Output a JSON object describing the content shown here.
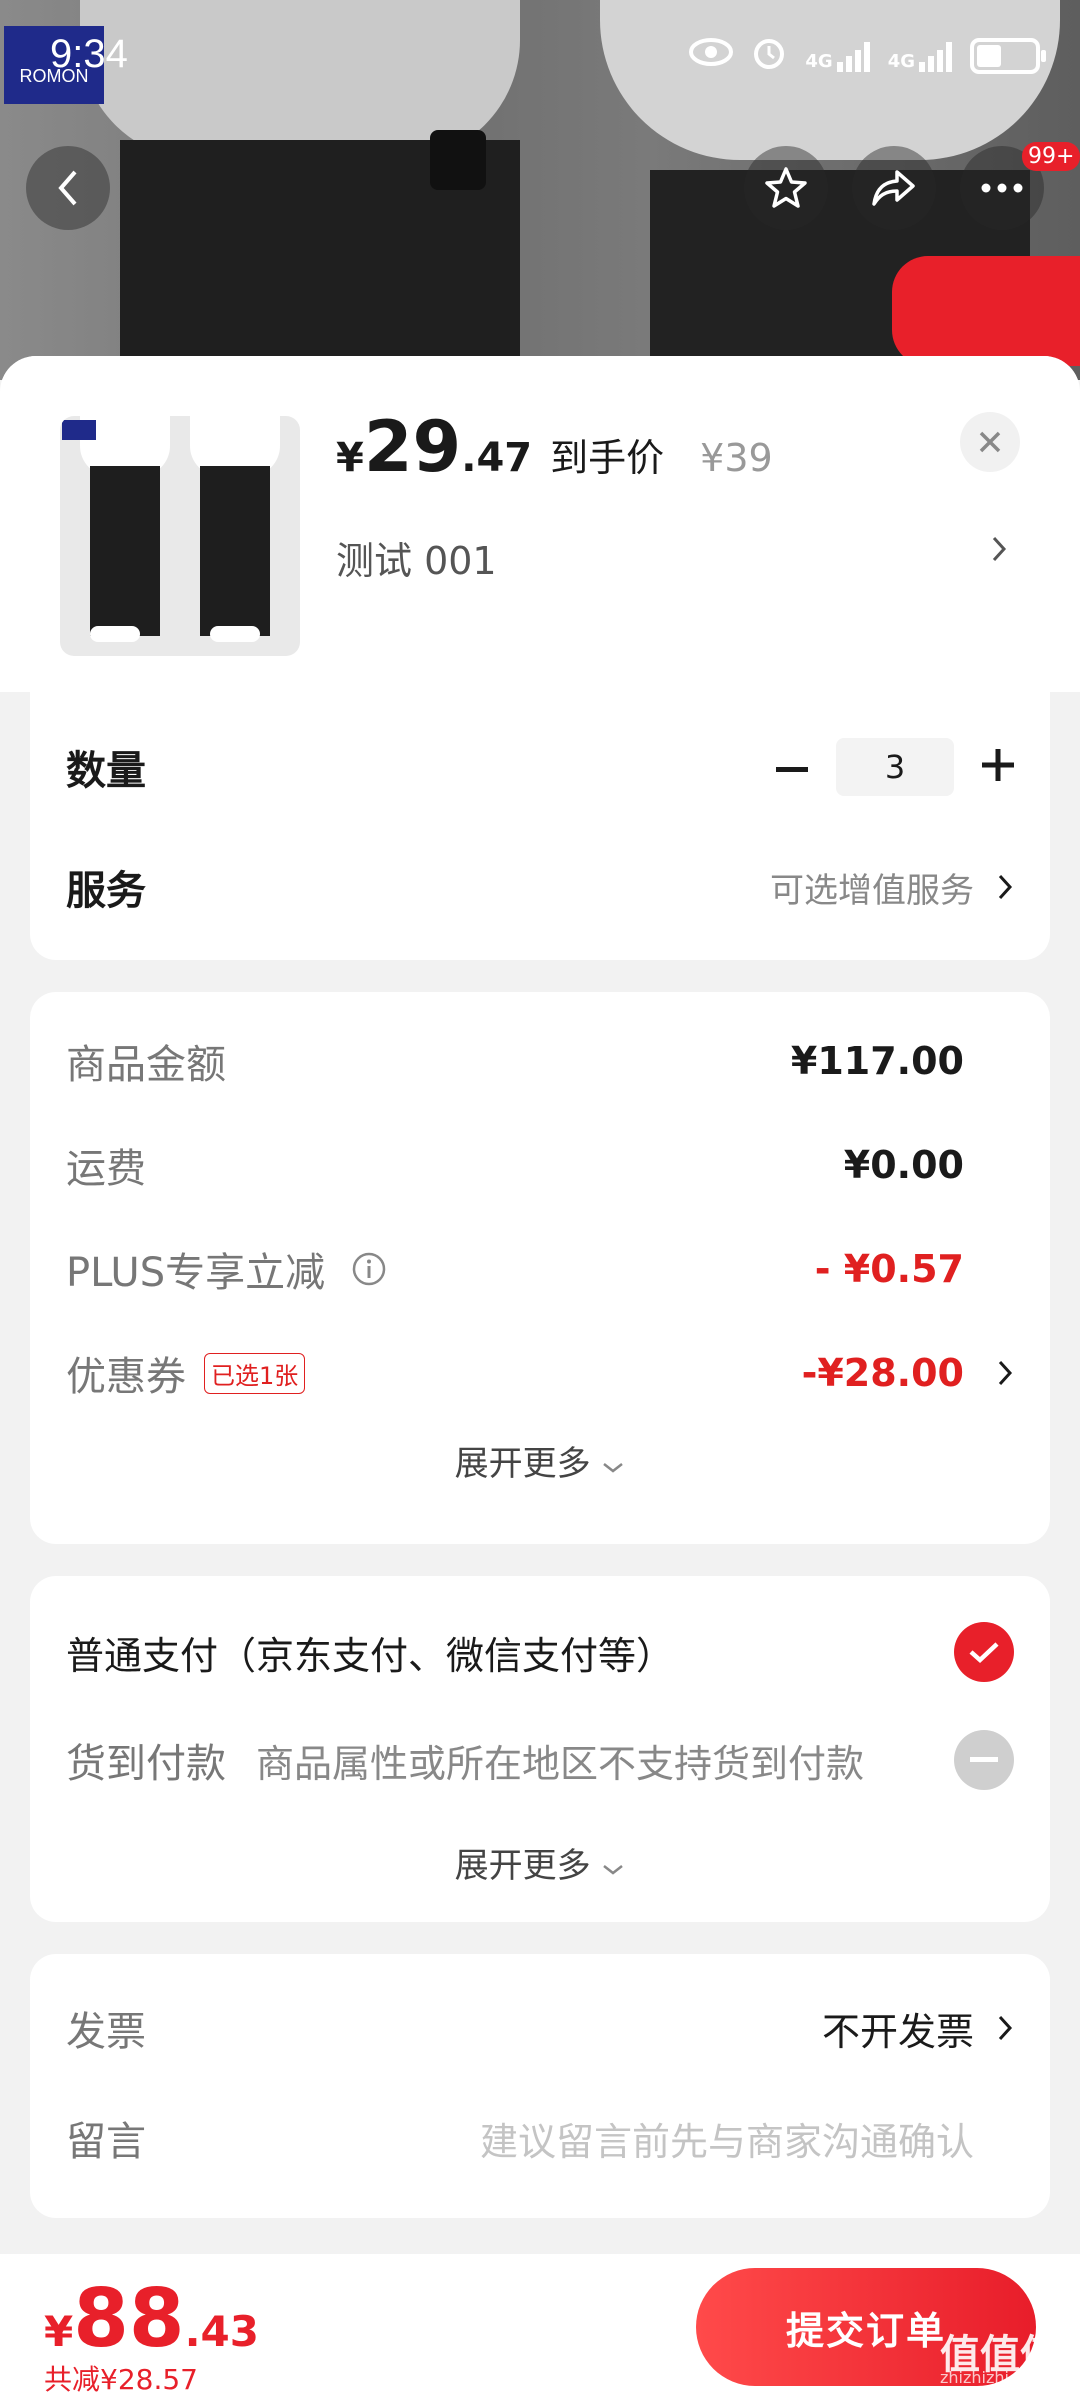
{
  "status_bar": {
    "time": "9:34",
    "net1": "4G",
    "net2": "4G"
  },
  "header": {
    "badge": "99+",
    "brand": "ROMON"
  },
  "product": {
    "currency": "¥",
    "price_int": "29",
    "price_dec": ".47",
    "price_label": "到手价",
    "original_price": "¥39",
    "variant": "测试  001"
  },
  "options": {
    "quantity_label": "数量",
    "quantity": "3",
    "service_label": "服务",
    "service_value": "可选增值服务"
  },
  "costs": {
    "items": [
      {
        "label": "商品金额",
        "value": "¥117.00"
      },
      {
        "label": "运费",
        "value": "¥0.00"
      },
      {
        "label": "PLUS专享立减",
        "value": "- ¥0.57"
      },
      {
        "label": "优惠券",
        "tag": "已选1张",
        "value": "-¥28.00"
      }
    ],
    "more": "展开更多"
  },
  "payment": {
    "normal": "普通支付（京东支付、微信支付等）",
    "cod_label": "货到付款",
    "cod_note": "商品属性或所在地区不支持货到付款",
    "more": "展开更多"
  },
  "extra": {
    "invoice_label": "发票",
    "invoice_value": "不开发票",
    "message_label": "留言",
    "message_placeholder": "建议留言前先与商家沟通确认"
  },
  "footer": {
    "currency": "¥",
    "total_int": "88",
    "total_dec": ".43",
    "saved": "共减¥28.57",
    "submit": "提交订单"
  },
  "watermark": {
    "text": "值值值",
    "sub": "zhizhizhi.com"
  },
  "colors": {
    "accent": "#e8202a",
    "bg": "#f2f2f2"
  }
}
